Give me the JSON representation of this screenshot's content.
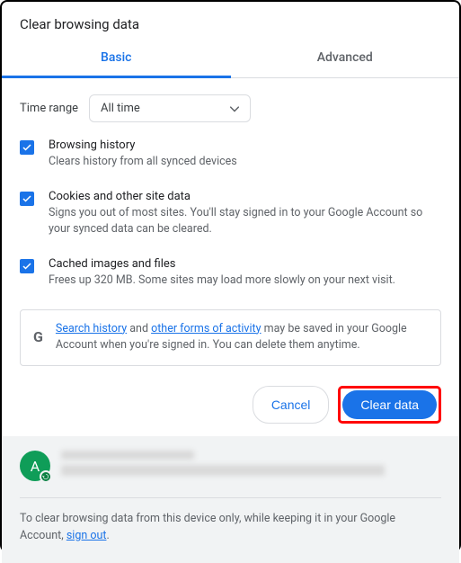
{
  "title": "Clear browsing data",
  "tabs": {
    "basic": "Basic",
    "advanced": "Advanced"
  },
  "timeRange": {
    "label": "Time range",
    "value": "All time"
  },
  "items": [
    {
      "title": "Browsing history",
      "desc": "Clears history from all synced devices"
    },
    {
      "title": "Cookies and other site data",
      "desc": "Signs you out of most sites. You'll stay signed in to your Google Account so your synced data can be cleared."
    },
    {
      "title": "Cached images and files",
      "desc": "Frees up 320 MB. Some sites may load more slowly on your next visit."
    }
  ],
  "notice": {
    "link1": "Search history",
    "mid1": " and ",
    "link2": "other forms of activity",
    "rest": " may be saved in your Google Account when you're signed in. You can delete them anytime."
  },
  "buttons": {
    "cancel": "Cancel",
    "clear": "Clear data"
  },
  "avatarLetter": "A",
  "footer": {
    "text1": "To clear browsing data from this device only, while keeping it in your Google Account, ",
    "link": "sign out",
    "text2": "."
  }
}
